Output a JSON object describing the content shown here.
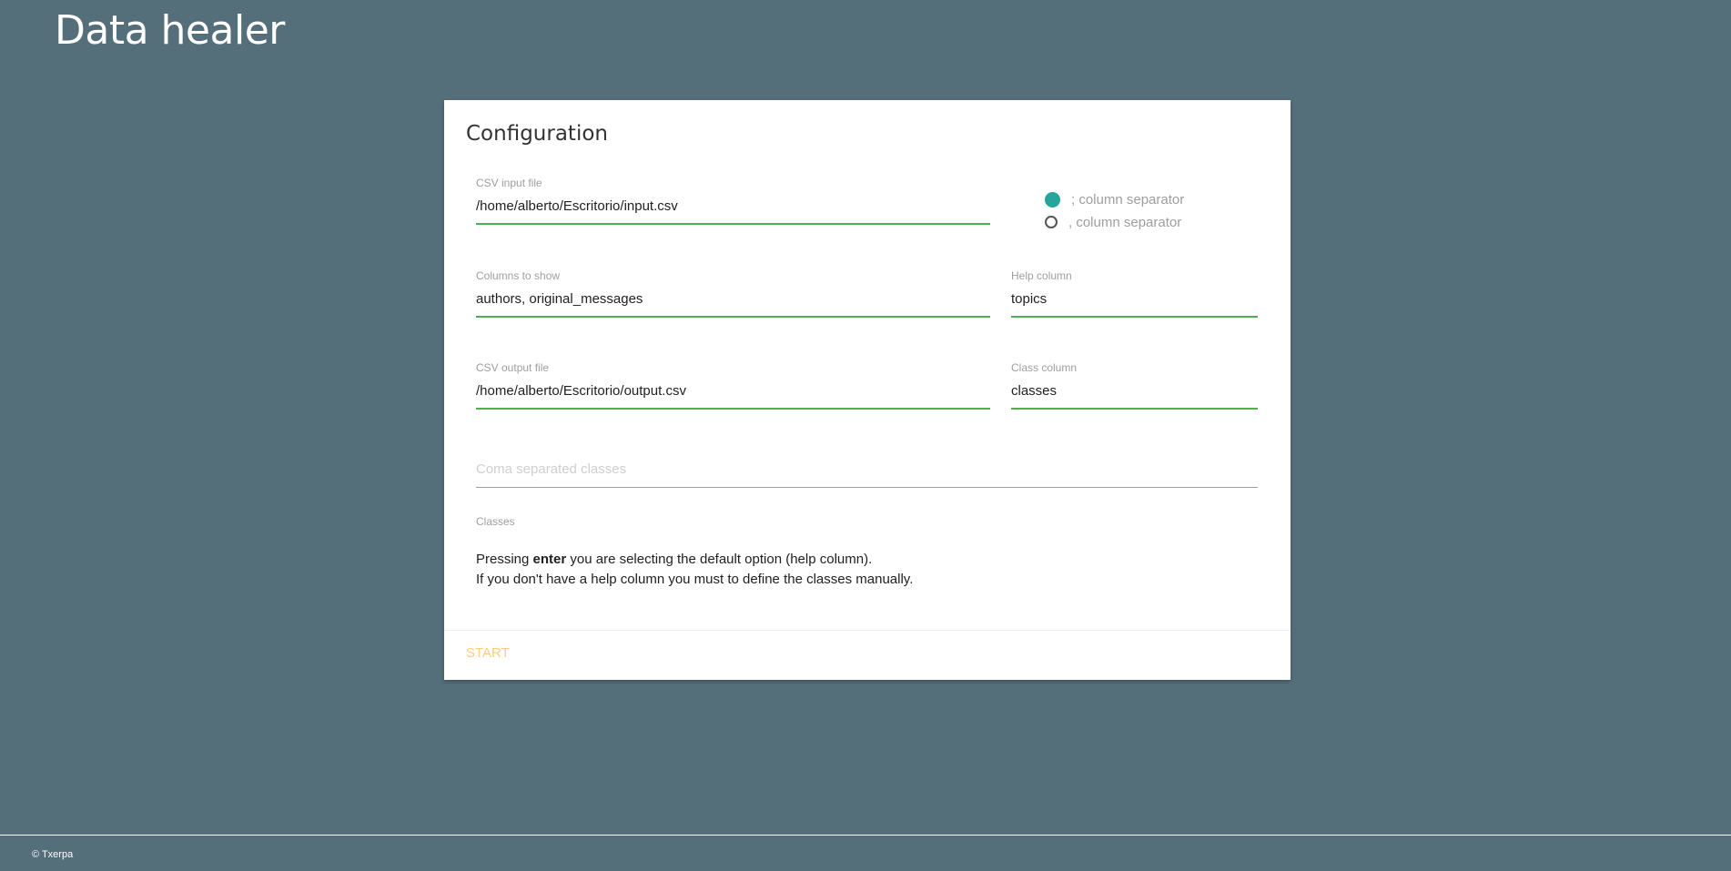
{
  "app": {
    "title": "Data healer"
  },
  "config": {
    "title": "Configuration",
    "csv_input": {
      "label": "CSV input file",
      "value": "/home/alberto/Escritorio/input.csv"
    },
    "separators": [
      {
        "label": "; column separator",
        "checked": true
      },
      {
        "label": ", column separator",
        "checked": false
      }
    ],
    "columns_to_show": {
      "label": "Columns to show",
      "value": "authors, original_messages"
    },
    "help_column": {
      "label": "Help column",
      "value": "topics"
    },
    "csv_output": {
      "label": "CSV output file",
      "value": "/home/alberto/Escritorio/output.csv"
    },
    "class_column": {
      "label": "Class column",
      "value": "classes"
    },
    "classes_input": {
      "placeholder": "Coma separated classes",
      "value": ""
    },
    "classes_label": "Classes",
    "help_text": {
      "line1_before": "Pressing ",
      "line1_bold": "enter",
      "line1_after": " you are selecting the default option (help column).",
      "line2": "If you don't have a help column you must to define the classes manually."
    },
    "start_label": "START"
  },
  "colors": {
    "background": "#546e7a",
    "accent_green": "#4caf50",
    "radio_teal": "#26a69a",
    "start_disabled": "#ffcc80"
  },
  "footer": {
    "text": "© Txerpa"
  }
}
